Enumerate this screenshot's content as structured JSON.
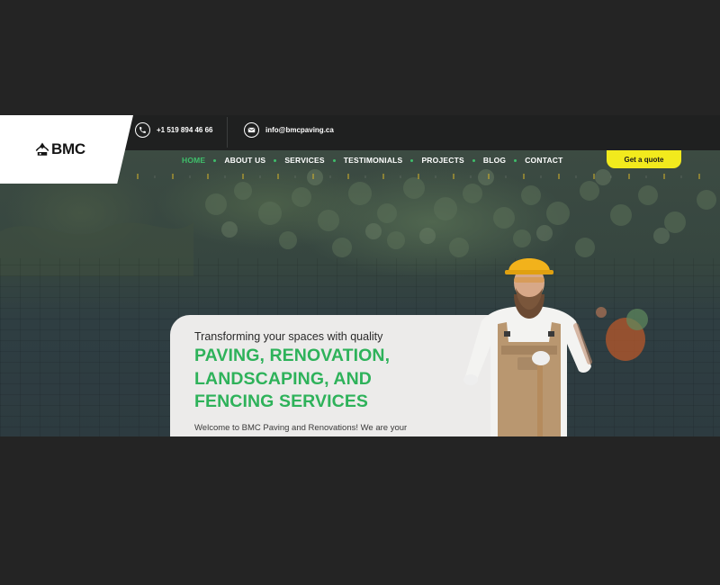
{
  "brand": {
    "name": "BMC"
  },
  "contact": {
    "phone": "+1 519 894 46 66",
    "email": "info@bmcpaving.ca"
  },
  "nav": {
    "items": [
      {
        "label": "HOME",
        "active": true
      },
      {
        "label": "ABOUT US"
      },
      {
        "label": "SERVICES"
      },
      {
        "label": "TESTIMONIALS"
      },
      {
        "label": "PROJECTS"
      },
      {
        "label": "BLOG"
      },
      {
        "label": "CONTACT"
      }
    ],
    "cta_label": "Get a quote"
  },
  "hero": {
    "kicker": "Transforming your spaces with quality",
    "headline_lines": [
      "PAVING, RENOVATION,",
      "LANDSCAPING, AND",
      "FENCING SERVICES"
    ],
    "intro": "Welcome to BMC Paving and Renovations! We are your"
  },
  "colors": {
    "accent_green": "#2eb25a",
    "cta_yellow": "#f2ea1d",
    "topbar": "#1f2020"
  },
  "icons": [
    "bmc-logo-icon",
    "phone-icon",
    "email-icon"
  ]
}
